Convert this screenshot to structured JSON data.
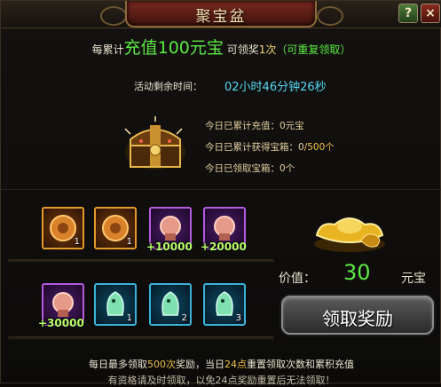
{
  "window": {
    "title": "聚宝盆",
    "help_label": "?",
    "close_label": "×"
  },
  "promo": {
    "prefix": "每累计",
    "highlight": "充值100元宝",
    "middle": "可领奖",
    "times": "1次",
    "suffix": "（可重复领取）"
  },
  "timer": {
    "label": "活动剩余时间：",
    "value": "02小时46分钟26秒"
  },
  "stats": {
    "charged_label": "今日已累计充值：",
    "charged_value": "0元宝",
    "chests_label": "今日已累计获得宝箱：",
    "chests_value": "0",
    "chests_max": "/500个",
    "claimed_label": "今日已领取宝箱：",
    "claimed_value": "0个"
  },
  "rewards_row1": [
    {
      "rarity": "orange",
      "icon": "bronze-medallion-icon",
      "count": "1"
    },
    {
      "rarity": "orange",
      "icon": "bronze-medallion-icon",
      "count": "1"
    },
    {
      "rarity": "purple",
      "icon": "pink-seal-icon",
      "qty": "+10000"
    },
    {
      "rarity": "purple",
      "icon": "pink-seal-icon",
      "qty": "+20000"
    }
  ],
  "rewards_row2": [
    {
      "rarity": "purple",
      "icon": "pink-seal-icon",
      "qty": "+30000"
    },
    {
      "rarity": "blue",
      "icon": "green-spirit-icon",
      "count": "1"
    },
    {
      "rarity": "blue",
      "icon": "green-spirit-icon",
      "count": "2"
    },
    {
      "rarity": "blue",
      "icon": "green-spirit-icon",
      "count": "3"
    }
  ],
  "value": {
    "label": "价值：",
    "amount": "30",
    "unit": "元宝"
  },
  "claim_button": "领取奖励",
  "footer": {
    "line1_a": "每日最多领取",
    "line1_b": "500次",
    "line1_c": "奖励，当日",
    "line1_d": "24点",
    "line1_e": "重置领取次数和累积充值",
    "line2": "有资格请及时领取，以免24点奖励重置后无法领取！"
  },
  "colors": {
    "accent_green": "#5bea43",
    "timer_cyan": "#55d7f3",
    "gold": "#f1c24a"
  }
}
